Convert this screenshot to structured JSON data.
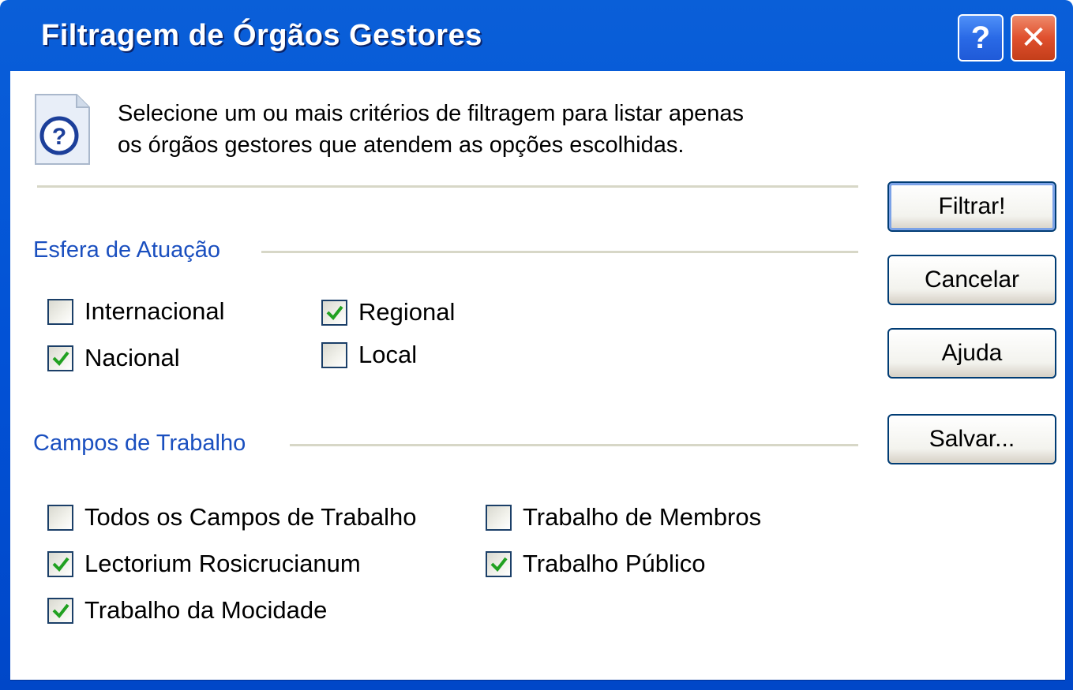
{
  "window": {
    "title": "Filtragem de Órgãos Gestores",
    "help_glyph": "?",
    "close_glyph": "✕"
  },
  "intro": {
    "icon": "help-document-icon",
    "line1": "Selecione um ou mais critérios de filtragem para listar apenas",
    "line2": "os órgãos gestores que atendem as opções escolhidas."
  },
  "esfera": {
    "label": "Esfera de Atuação",
    "options": [
      {
        "label": "Internacional",
        "checked": false
      },
      {
        "label": "Nacional",
        "checked": true
      },
      {
        "label": "Regional",
        "checked": true
      },
      {
        "label": "Local",
        "checked": false
      }
    ]
  },
  "campos": {
    "label": "Campos de Trabalho",
    "options": [
      {
        "label": "Todos os Campos de Trabalho",
        "checked": false
      },
      {
        "label": "Lectorium Rosicrucianum",
        "checked": true
      },
      {
        "label": "Trabalho da Mocidade",
        "checked": true
      },
      {
        "label": "Trabalho de Membros",
        "checked": false
      },
      {
        "label": "Trabalho Público",
        "checked": true
      }
    ]
  },
  "buttons": {
    "filtrar": "Filtrar!",
    "cancelar": "Cancelar",
    "ajuda": "Ajuda",
    "salvar": "Salvar..."
  },
  "colors": {
    "title_bar": "#0252d6",
    "section_label": "#1a4fbf",
    "check": "#21a121",
    "close_button": "#e0502e"
  }
}
